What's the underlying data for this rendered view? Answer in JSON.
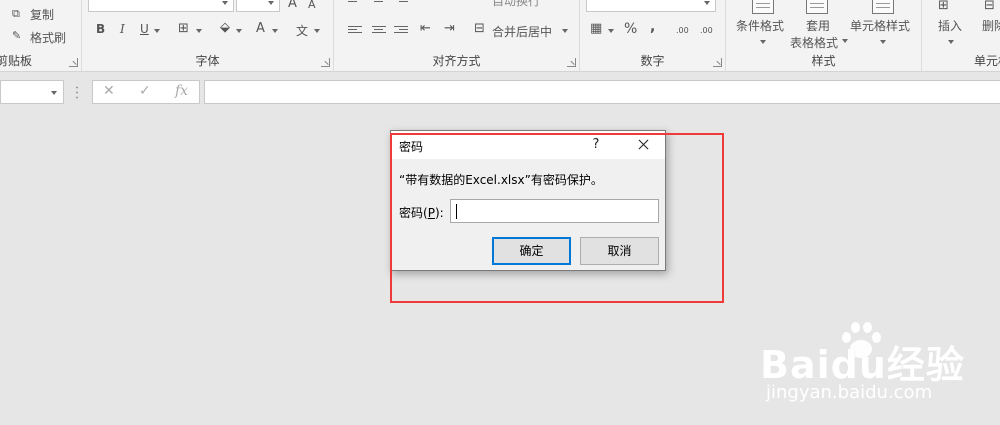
{
  "ribbon": {
    "clipboard": {
      "label": "剪贴板",
      "copy": "复制",
      "format_painter": "格式刷"
    },
    "font": {
      "label": "字体",
      "bold": "B",
      "italic": "I",
      "underline": "U",
      "font_color": "A",
      "grow_font": "A",
      "shrink_font": "A",
      "phonetic": "文"
    },
    "alignment": {
      "label": "对齐方式",
      "merge_center": "合并后居中",
      "wrap_text": "自动换行"
    },
    "number": {
      "label": "数字",
      "percent": "%",
      "comma": ",",
      "increase_decimal": ".00",
      "decrease_decimal": ".00"
    },
    "styles": {
      "label": "样式",
      "conditional_format": "条件格式",
      "table_format_line1": "套用",
      "table_format_line2": "表格格式",
      "cell_styles": "单元格样式"
    },
    "cells": {
      "label": "单元格",
      "insert": "插入",
      "delete": "删除"
    }
  },
  "formula_bar": {
    "cancel_glyph": "✕",
    "enter_glyph": "✓",
    "fx_glyph": "fx"
  },
  "dialog": {
    "title": "密码",
    "help_glyph": "?",
    "message": "“带有数据的Excel.xlsx”有密码保护。",
    "password_label_prefix": "密码(",
    "password_label_key": "P",
    "password_label_suffix": "):",
    "password_value": "",
    "ok_label": "确定",
    "cancel_label": "取消"
  },
  "watermark": {
    "brand": "Baidu经验",
    "url": "jingyan.baidu.com"
  },
  "colors": {
    "highlight": "#ee3a3a",
    "primary_border": "#0078d7"
  }
}
